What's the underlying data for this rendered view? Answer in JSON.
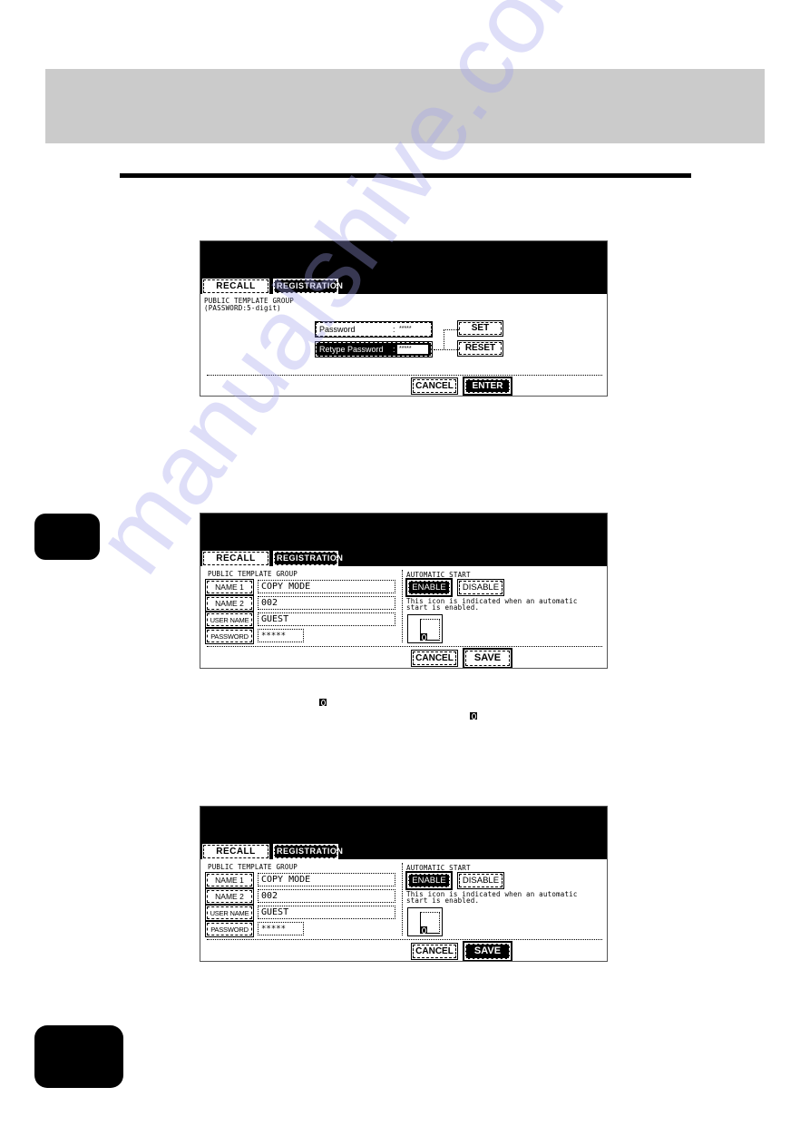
{
  "page": {
    "watermark": "manualshive.com"
  },
  "screens": [
    {
      "tabs": [
        {
          "label": "RECALL",
          "selected": false
        },
        {
          "label": "REGISTRATION",
          "selected": true
        }
      ],
      "group_title": "PUBLIC TEMPLATE GROUP",
      "group_subtitle": "(PASSWORD:5-digit)",
      "password_field": {
        "label": "Password",
        "colon": ":",
        "value": "*****"
      },
      "retype_field": {
        "label": "Retype Password",
        "colon": ":",
        "value": "*****"
      },
      "set_label": "SET",
      "reset_label": "RESET",
      "cancel_label": "CANCEL",
      "confirm_label": "ENTER"
    },
    {
      "tabs": [
        {
          "label": "RECALL",
          "selected": false
        },
        {
          "label": "REGISTRATION",
          "selected": true
        }
      ],
      "group_title": "PUBLIC TEMPLATE GROUP",
      "rows": [
        {
          "label": "NAME 1",
          "value": "COPY MODE"
        },
        {
          "label": "NAME 2",
          "value": "002"
        },
        {
          "label": "USER NAME",
          "value": "GUEST"
        },
        {
          "label": "PASSWORD",
          "value": "*****"
        }
      ],
      "auto_start_title": "AUTOMATIC START",
      "enable_label": "ENABLE",
      "disable_label": "DISABLE",
      "auto_start_selected": "ENABLE",
      "auto_start_note": "This icon is indicated when an automatic start is enabled.",
      "cancel_label": "CANCEL",
      "confirm_label": "SAVE"
    },
    {
      "tabs": [
        {
          "label": "RECALL",
          "selected": false
        },
        {
          "label": "REGISTRATION",
          "selected": true
        }
      ],
      "group_title": "PUBLIC TEMPLATE GROUP",
      "rows": [
        {
          "label": "NAME 1",
          "value": "COPY MODE"
        },
        {
          "label": "NAME 2",
          "value": "002"
        },
        {
          "label": "USER NAME",
          "value": "GUEST"
        },
        {
          "label": "PASSWORD",
          "value": "*****"
        }
      ],
      "auto_start_title": "AUTOMATIC START",
      "enable_label": "ENABLE",
      "disable_label": "DISABLE",
      "auto_start_selected": "ENABLE",
      "auto_start_note": "This icon is indicated when an automatic start is enabled.",
      "cancel_label": "CANCEL",
      "confirm_label": "SAVE",
      "confirm_pressed": true
    }
  ],
  "icons": {
    "auto_start": "auto-start-icon"
  }
}
